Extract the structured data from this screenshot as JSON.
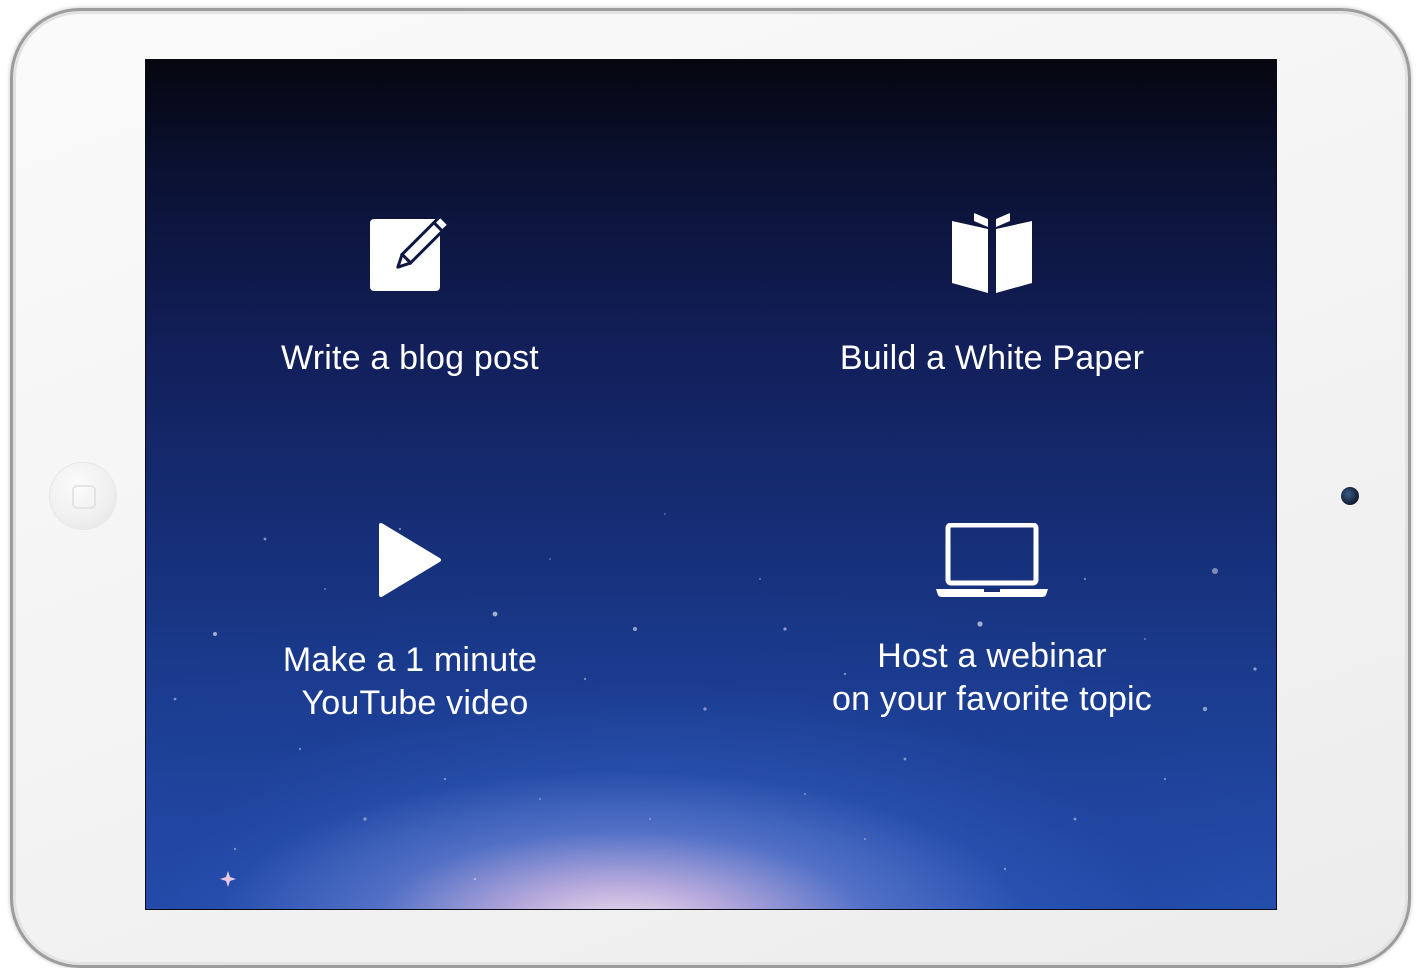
{
  "tiles": [
    {
      "label": "Write a blog post",
      "icon": "pencil-square-icon"
    },
    {
      "label": "Build a White Paper",
      "icon": "open-book-icon"
    },
    {
      "label_line1": "Make a 1 minute",
      "label_line2": "YouTube video",
      "icon": "play-icon"
    },
    {
      "label_line1": "Host a webinar",
      "label_line2": "on your favorite topic",
      "icon": "laptop-icon"
    }
  ],
  "colors": {
    "screen_top": "#05060f",
    "screen_bottom": "#2650b0",
    "glow": "#ffe8f0",
    "text": "#ffffff",
    "bezel": "#f5f5f5"
  }
}
